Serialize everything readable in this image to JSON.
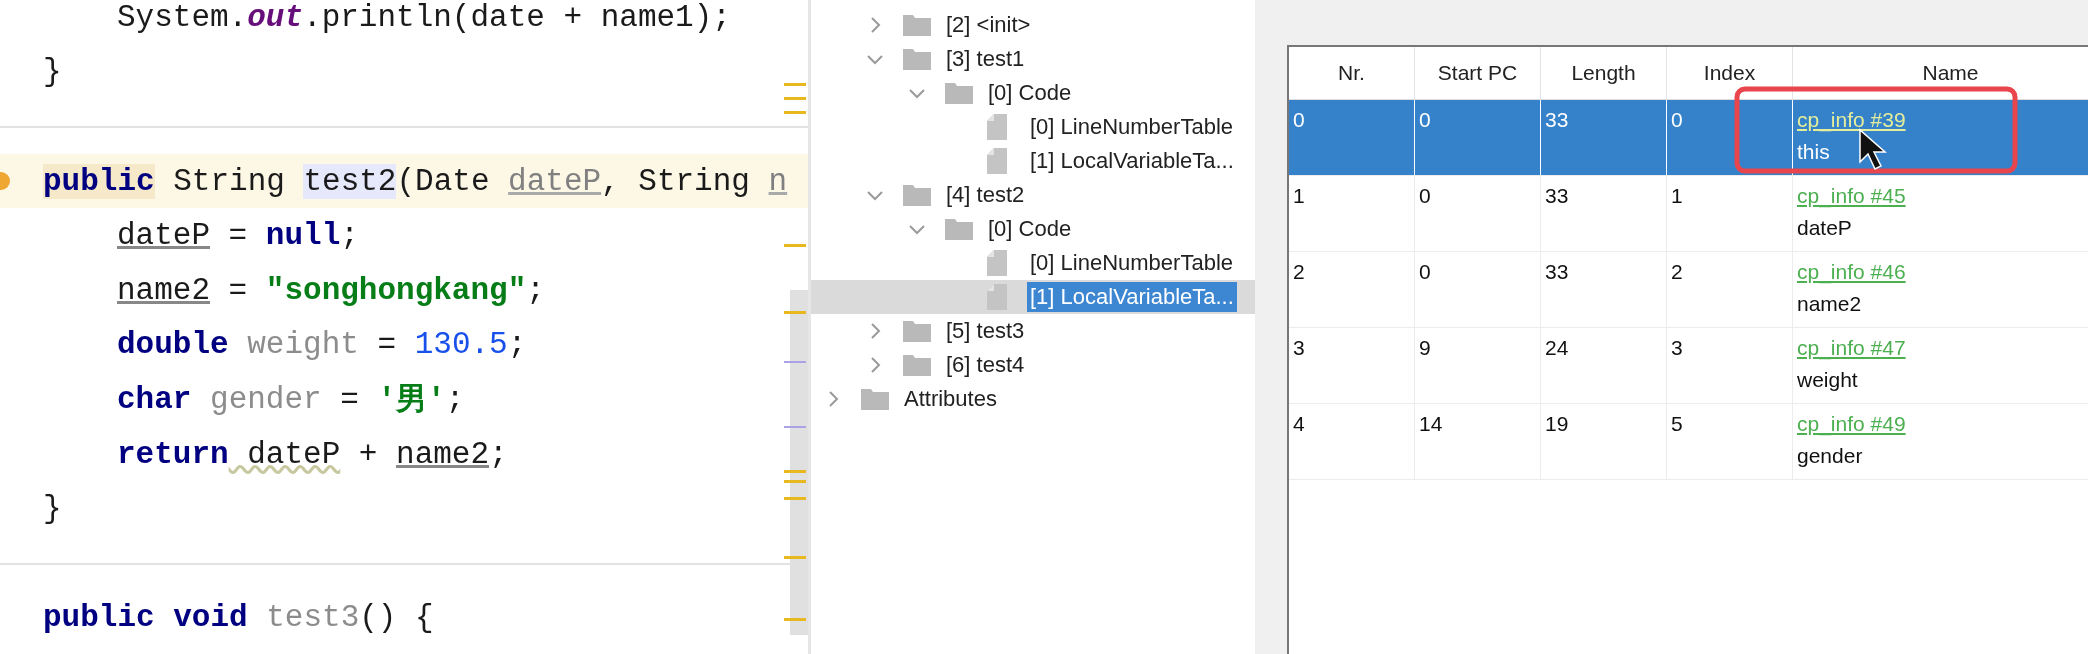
{
  "editor": {
    "lines": [
      {
        "kind": "body",
        "tokens": [
          {
            "kind": "text",
            "text": "System."
          },
          {
            "kind": "static",
            "text": "out"
          },
          {
            "kind": "text",
            "text": ".println(date + name1);"
          }
        ]
      },
      {
        "kind": "outer",
        "tokens": [
          {
            "kind": "text",
            "text": "}"
          }
        ]
      },
      {
        "kind": "outer",
        "new_block": true,
        "current": true,
        "tokens": [
          {
            "kind": "keyword_hl",
            "text": "public"
          },
          {
            "kind": "text",
            "text": " String "
          },
          {
            "kind": "decl_hl",
            "text": "test2"
          },
          {
            "kind": "text",
            "text": "(Date "
          },
          {
            "kind": "param",
            "text": "dateP"
          },
          {
            "kind": "text",
            "text": ", String "
          },
          {
            "kind": "param",
            "text": "n"
          }
        ]
      },
      {
        "kind": "body",
        "tokens": [
          {
            "kind": "var",
            "text": "dateP"
          },
          {
            "kind": "text",
            "text": " = "
          },
          {
            "kind": "keyword",
            "text": "null"
          },
          {
            "kind": "text",
            "text": ";"
          }
        ]
      },
      {
        "kind": "body",
        "tokens": [
          {
            "kind": "var",
            "text": "name2"
          },
          {
            "kind": "text",
            "text": " = "
          },
          {
            "kind": "string",
            "text": "\"songhongkang\""
          },
          {
            "kind": "text",
            "text": ";"
          }
        ]
      },
      {
        "kind": "body",
        "tokens": [
          {
            "kind": "keyword",
            "text": "double"
          },
          {
            "kind": "unused",
            "text": " weight"
          },
          {
            "kind": "text",
            "text": " = "
          },
          {
            "kind": "number",
            "text": "130.5"
          },
          {
            "kind": "text",
            "text": ";"
          }
        ]
      },
      {
        "kind": "body",
        "tokens": [
          {
            "kind": "keyword",
            "text": "char"
          },
          {
            "kind": "unused",
            "text": " gender"
          },
          {
            "kind": "text",
            "text": " = "
          },
          {
            "kind": "string",
            "text": "'男'"
          },
          {
            "kind": "text",
            "text": ";"
          }
        ]
      },
      {
        "kind": "body",
        "tokens": [
          {
            "kind": "keyword",
            "text": "return"
          },
          {
            "kind": "warn",
            "text": " dateP"
          },
          {
            "kind": "text",
            "text": " + "
          },
          {
            "kind": "var",
            "text": "name2"
          },
          {
            "kind": "text",
            "text": ";"
          }
        ]
      },
      {
        "kind": "outer",
        "tokens": [
          {
            "kind": "text",
            "text": "}"
          }
        ]
      },
      {
        "kind": "outer",
        "new_block": true,
        "tokens": [
          {
            "kind": "keyword",
            "text": "public void"
          },
          {
            "kind": "unused",
            "text": " test3"
          },
          {
            "kind": "text",
            "text": "() {"
          }
        ]
      }
    ]
  },
  "tree": {
    "methods": [
      {
        "kind": "folder",
        "label": "[2] <init>",
        "expanded": false,
        "selected": false
      },
      {
        "kind": "folder",
        "label": "[3] test1",
        "expanded": true,
        "selected": false,
        "children": [
          {
            "kind": "folder",
            "label": "[0] Code",
            "expanded": true,
            "selected": false,
            "children": [
              {
                "kind": "file",
                "label": "[0] LineNumberTable",
                "selected": false
              },
              {
                "kind": "file",
                "label": "[1] LocalVariableTa...",
                "selected": false
              }
            ]
          }
        ]
      },
      {
        "kind": "folder",
        "label": "[4] test2",
        "expanded": true,
        "selected": false,
        "children": [
          {
            "kind": "folder",
            "label": "[0] Code",
            "expanded": true,
            "selected": false,
            "children": [
              {
                "kind": "file",
                "label": "[0] LineNumberTable",
                "selected": false
              },
              {
                "kind": "file",
                "label": "[1] LocalVariableTa...",
                "selected": true
              }
            ]
          }
        ]
      },
      {
        "kind": "folder",
        "label": "[5] test3",
        "expanded": false,
        "selected": false
      },
      {
        "kind": "folder",
        "label": "[6] test4",
        "expanded": false,
        "selected": false
      }
    ],
    "roots": [
      {
        "kind": "folder",
        "label": "Attributes",
        "expanded": false,
        "selected": false
      }
    ]
  },
  "table": {
    "columns": [
      "Nr.",
      "Start PC",
      "Length",
      "Index",
      "Name"
    ],
    "rows": [
      {
        "selected": true,
        "cells": [
          "0",
          "0",
          "33",
          "0"
        ],
        "link": "cp_info #39",
        "name": "this"
      },
      {
        "selected": false,
        "cells": [
          "1",
          "0",
          "33",
          "1"
        ],
        "link": "cp_info #45",
        "name": "dateP"
      },
      {
        "selected": false,
        "cells": [
          "2",
          "0",
          "33",
          "2"
        ],
        "link": "cp_info #46",
        "name": "name2"
      },
      {
        "selected": false,
        "cells": [
          "3",
          "9",
          "24",
          "3"
        ],
        "link": "cp_info #47",
        "name": "weight"
      },
      {
        "selected": false,
        "cells": [
          "4",
          "14",
          "19",
          "5"
        ],
        "link": "cp_info #49",
        "name": "gender"
      }
    ]
  }
}
